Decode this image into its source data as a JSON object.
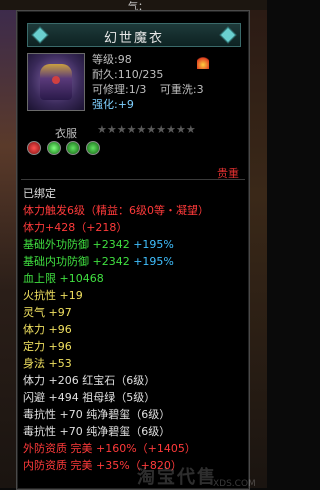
{
  "topbar": {
    "text": "气："
  },
  "item": {
    "name": "幻世魔衣",
    "level_label": "等级",
    "level": "98",
    "durability_label": "耐久",
    "durability": "110/235",
    "repairable_label": "可修理",
    "repairable": "1/3",
    "rewash_label": "可重洗",
    "rewash": "3",
    "enhance_label": "强化",
    "enhance": "+9",
    "type": "衣服",
    "stars_total": 10,
    "stars_filled": 0,
    "rarity": "贵重"
  },
  "lines": [
    {
      "text": "已绑定",
      "color": "white"
    },
    {
      "text": "体力触发6级（精益：6级0等・凝望）",
      "color": "red"
    },
    {
      "text": "体力+428（+218）",
      "color": "red"
    },
    {
      "label": "基础外功防御 +2342 ",
      "pct": "+195%",
      "color": "green"
    },
    {
      "label": "基础内功防御 +2342 ",
      "pct": "+195%",
      "color": "green"
    },
    {
      "text": "血上限  +10468",
      "color": "green"
    },
    {
      "text": "火抗性  +19",
      "color": "yellow"
    },
    {
      "text": "灵气  +97",
      "color": "yellow"
    },
    {
      "text": "体力  +96",
      "color": "yellow"
    },
    {
      "text": "定力  +96",
      "color": "yellow"
    },
    {
      "text": "身法  +53",
      "color": "yellow"
    },
    {
      "text": "体力  +206  红宝石（6级）",
      "color": "white"
    },
    {
      "text": "闪避  +494  祖母绿（5级）",
      "color": "white"
    },
    {
      "text": "毒抗性  +70  纯净碧玺（6级）",
      "color": "white"
    },
    {
      "text": "毒抗性  +70  纯净碧玺（6级）",
      "color": "white"
    },
    {
      "text": "外防资质  完美  +160%（+1405）",
      "color": "red"
    },
    {
      "text": "内防资质  完美  +35%（+820）",
      "color": "red"
    }
  ],
  "watermark": {
    "text": "淘宝代售",
    "url": "XDS.COM"
  },
  "colors": {
    "red": "#ff3a3a",
    "green": "#40e040",
    "yellow": "#f0e060",
    "blue": "#40c0ff"
  }
}
